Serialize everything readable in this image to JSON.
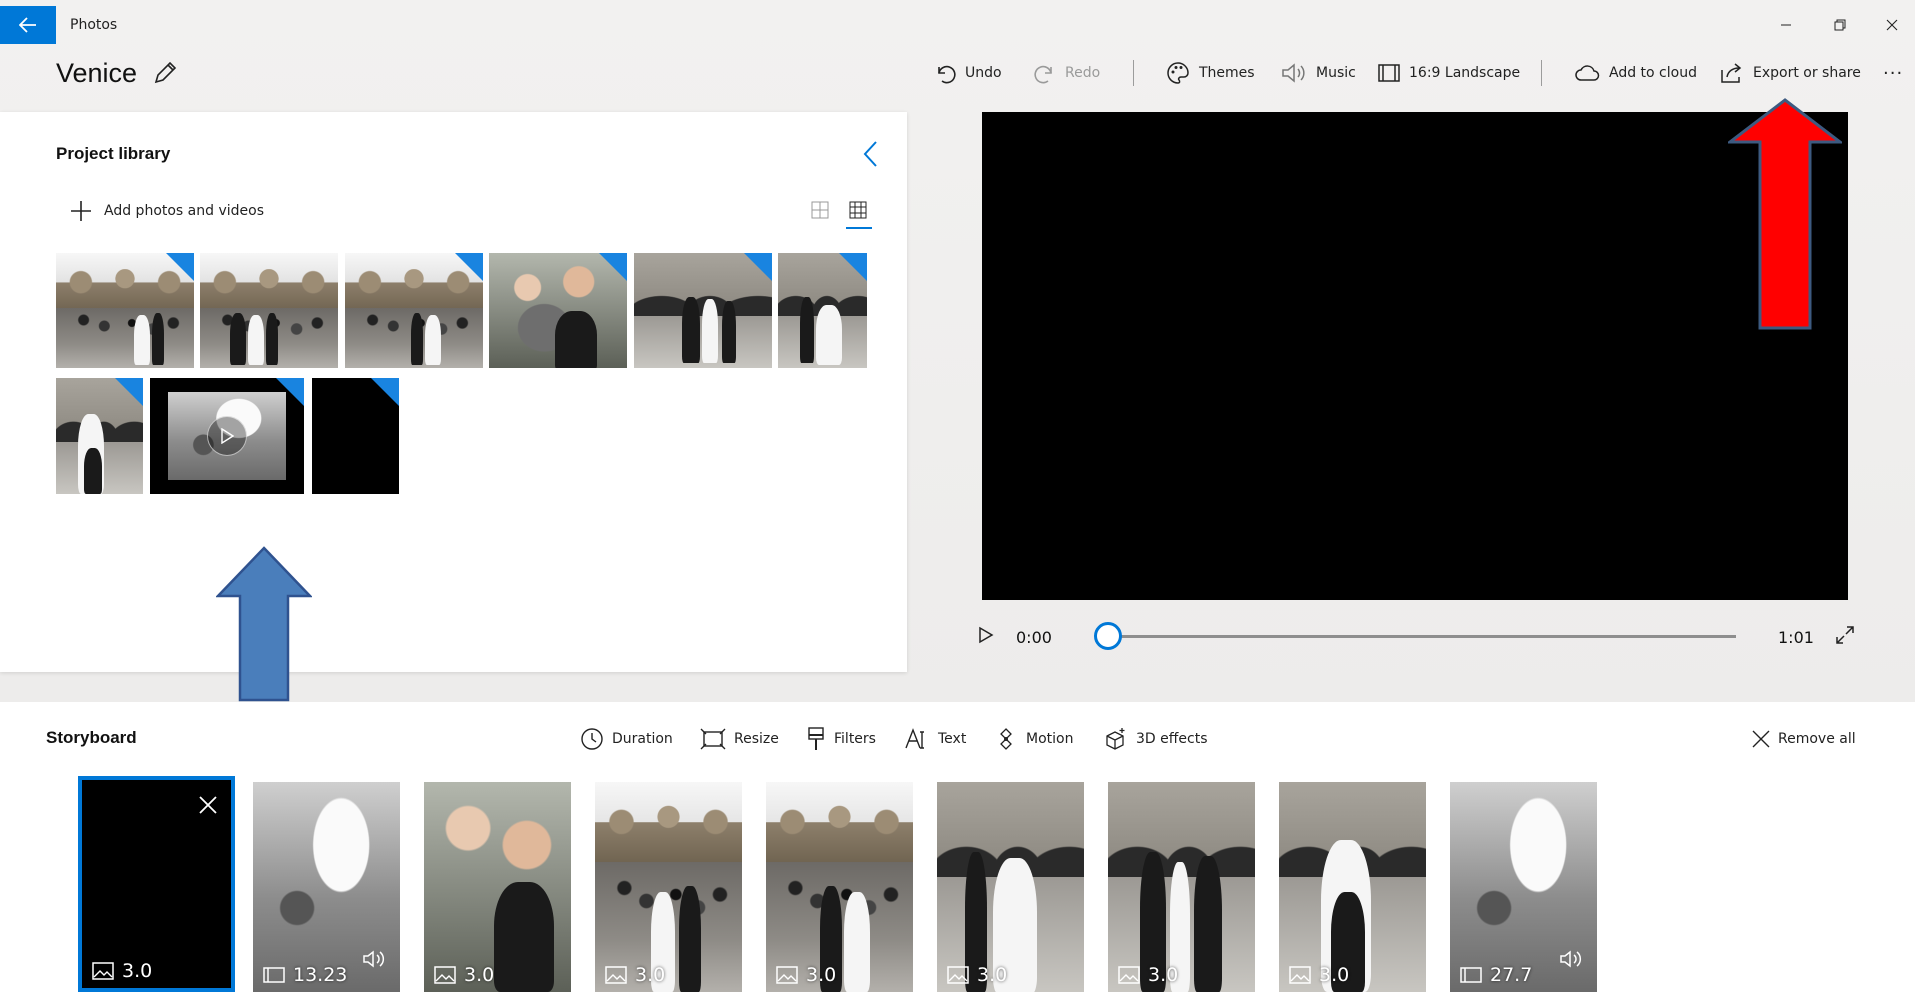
{
  "window": {
    "app_name": "Photos",
    "controls": [
      "minimize-icon",
      "restore-icon",
      "close-icon"
    ]
  },
  "project": {
    "title": "Venice"
  },
  "toolbar": {
    "undo": "Undo",
    "redo": "Redo",
    "themes": "Themes",
    "music": "Music",
    "aspect": "16:9 Landscape",
    "add_to_cloud": "Add to cloud",
    "export": "Export or share",
    "more": "···"
  },
  "library": {
    "title": "Project library",
    "add_label": "Add photos and videos",
    "items": [
      {
        "kind": "photo",
        "scene": "basilica"
      },
      {
        "kind": "photo",
        "scene": "basilica"
      },
      {
        "kind": "photo",
        "scene": "basilica"
      },
      {
        "kind": "photo",
        "scene": "pigeons"
      },
      {
        "kind": "photo",
        "scene": "arcade"
      },
      {
        "kind": "photo",
        "scene": "arcade"
      },
      {
        "kind": "photo",
        "scene": "man"
      },
      {
        "kind": "video",
        "scene": "cafe"
      },
      {
        "kind": "title-card",
        "scene": "black"
      }
    ]
  },
  "player": {
    "current_time": "0:00",
    "total_time": "1:01",
    "progress": 0
  },
  "storyboard": {
    "title": "Storyboard",
    "tools": {
      "duration": "Duration",
      "resize": "Resize",
      "filters": "Filters",
      "text": "Text",
      "motion": "Motion",
      "effects": "3D effects",
      "remove_all": "Remove all"
    },
    "clips": [
      {
        "duration": "3.0",
        "kind": "image",
        "scene": "black",
        "selected": true
      },
      {
        "duration": "13.23",
        "kind": "video",
        "scene": "cafe",
        "audio": true
      },
      {
        "duration": "3.0",
        "kind": "image",
        "scene": "pigeons"
      },
      {
        "duration": "3.0",
        "kind": "image",
        "scene": "basilica"
      },
      {
        "duration": "3.0",
        "kind": "image",
        "scene": "basilica"
      },
      {
        "duration": "3.0",
        "kind": "image",
        "scene": "arcade"
      },
      {
        "duration": "3.0",
        "kind": "image",
        "scene": "arcade"
      },
      {
        "duration": "3.0",
        "kind": "image",
        "scene": "man"
      },
      {
        "duration": "27.7",
        "kind": "video",
        "scene": "cafe",
        "audio": true
      }
    ]
  },
  "annotations": {
    "red_arrow_color": "#ff0000",
    "blue_arrow_color": "#4a7ebb",
    "accent": "#0078d7"
  }
}
